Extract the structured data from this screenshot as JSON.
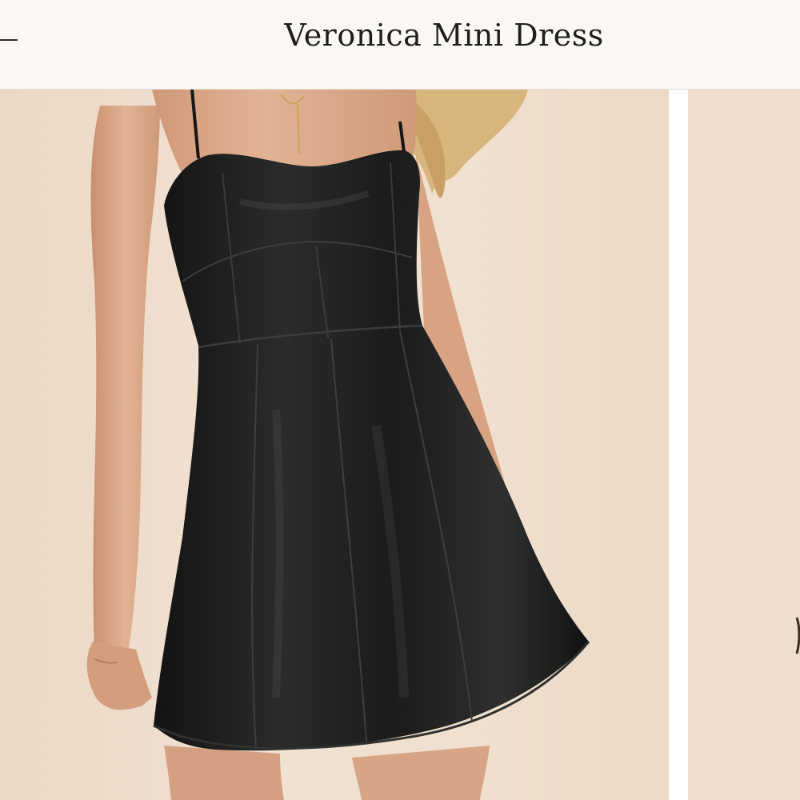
{
  "header": {
    "back_icon": "back-dash-icon",
    "title": "Veronica Mini Dress"
  },
  "gallery": {
    "main_image": "model wearing black faux leather mini dress",
    "next_image": "next product photo preview"
  },
  "colors": {
    "header_bg": "#fbf7f3",
    "backdrop": "#f0e0cf",
    "dress": "#1c1d1c",
    "skin": "#d9a585",
    "hair": "#d9b47a"
  }
}
